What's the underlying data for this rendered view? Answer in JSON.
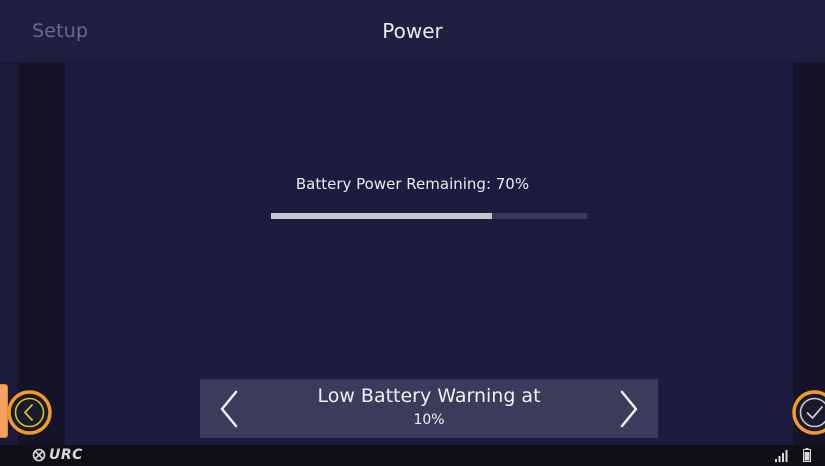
{
  "header": {
    "left_title": "Setup",
    "title": "Power"
  },
  "battery": {
    "label": "Battery Power Remaining: 70%",
    "level_percent": 70
  },
  "warning": {
    "label": "Low Battery Warning at",
    "value": "10%"
  },
  "footer": {
    "logo_text": "URC"
  },
  "icons": {
    "back": "chevron-left-circle-icon",
    "ok": "check-circle-icon",
    "prev": "chevron-left-icon",
    "next": "chevron-right-icon",
    "signal": "signal-icon",
    "battery": "battery-icon",
    "logo": "urc-logo-icon"
  },
  "colors": {
    "accent": "#f39a2b",
    "background": "#1d1c3f",
    "header": "#201f42",
    "warning_bar": "#3c3b5c",
    "progress_fill": "#c6c6d1",
    "progress_track": "#393859"
  }
}
